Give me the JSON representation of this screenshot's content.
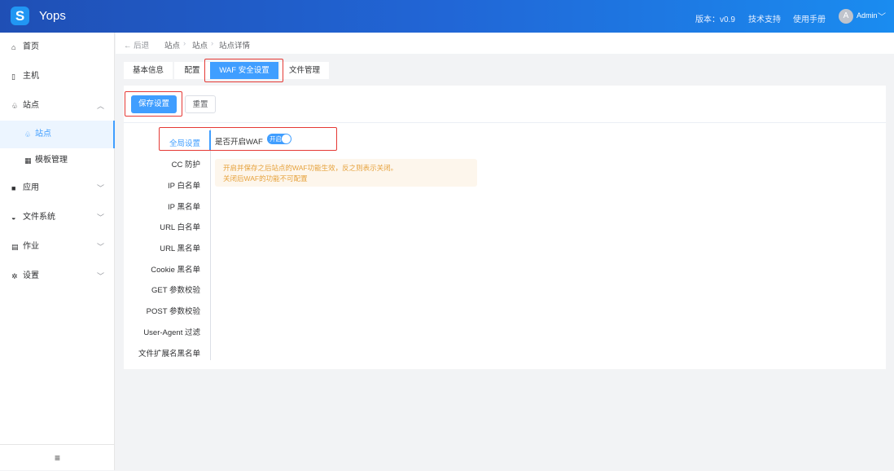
{
  "header": {
    "logo": "S",
    "brand": "Yops",
    "version": "版本：v0.9",
    "support": "技术支持",
    "manual": "使用手册",
    "avatar": "A",
    "user": "Admin"
  },
  "sidebar": {
    "items": [
      {
        "label": "首页",
        "icon": "home-icon"
      },
      {
        "label": "主机",
        "icon": "server-icon"
      },
      {
        "label": "站点",
        "icon": "sitemap-icon"
      },
      {
        "label": "站点",
        "icon": "sitemap-icon"
      },
      {
        "label": "模板管理",
        "icon": "template-icon"
      },
      {
        "label": "应用",
        "icon": "apps-icon"
      },
      {
        "label": "文件系统",
        "icon": "disk-icon"
      },
      {
        "label": "作业",
        "icon": "job-icon"
      },
      {
        "label": "设置",
        "icon": "gear-icon"
      }
    ],
    "collapse": "≡"
  },
  "breadcrumb": {
    "back": "后退",
    "items": [
      "站点",
      "站点",
      "站点详情"
    ]
  },
  "tabs": [
    "基本信息",
    "配置",
    "WAF 安全设置",
    "文件管理"
  ],
  "actions": {
    "save": "保存设置",
    "reset": "重置"
  },
  "waf_menu": [
    "全局设置",
    "CC 防护",
    "IP 白名单",
    "IP 黑名单",
    "URL 白名单",
    "URL 黑名单",
    "Cookie 黑名单",
    "GET 参数校验",
    "POST 参数校验",
    "User-Agent 过滤",
    "文件扩展名黑名单"
  ],
  "global": {
    "label": "是否开启WAF",
    "switch_text": "开启",
    "enabled": true,
    "tips": [
      "开启并保存之后站点的WAF功能生效，反之则表示关闭。",
      "关闭后WAF的功能不可配置"
    ]
  }
}
